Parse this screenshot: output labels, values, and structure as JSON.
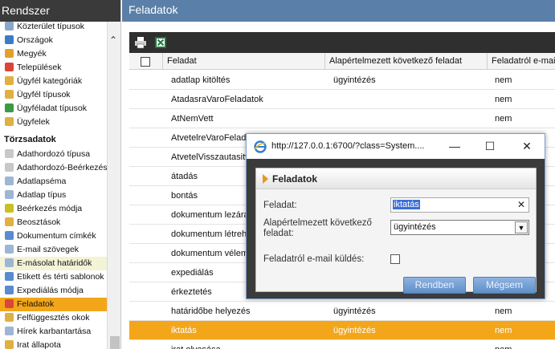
{
  "sidebar": {
    "title": "Rendszer",
    "items_top": [
      {
        "label": "Közterület típusok",
        "icon": "map-icon",
        "color": "#8aa6c8"
      },
      {
        "label": "Országok",
        "icon": "globe-icon",
        "color": "#3c7bc8"
      },
      {
        "label": "Megyék",
        "icon": "map-pin-icon",
        "color": "#e3a02b"
      },
      {
        "label": "Települések",
        "icon": "stop-icon",
        "color": "#d9463a"
      },
      {
        "label": "Ügyfél kategóriák",
        "icon": "users-icon",
        "color": "#e0b043"
      },
      {
        "label": "Ügyfél típusok",
        "icon": "users-icon",
        "color": "#e0b043"
      },
      {
        "label": "Ügyféladat típusok",
        "icon": "bookmark-icon",
        "color": "#3a9a46"
      },
      {
        "label": "Ügyfelek",
        "icon": "clients-icon",
        "color": "#e0b043"
      }
    ],
    "section": "Törzsadatok",
    "items_bottom": [
      {
        "label": "Adathordozó típusa",
        "icon": "disc-icon",
        "color": "#c8c8c8"
      },
      {
        "label": "Adathordozó-Beérkezés",
        "icon": "disc-icon",
        "color": "#c8c8c8"
      },
      {
        "label": "Adatlapséma",
        "icon": "form-icon",
        "color": "#9eb6d4"
      },
      {
        "label": "Adatlap típus",
        "icon": "form-icon",
        "color": "#9eb6d4"
      },
      {
        "label": "Beérkezés módja",
        "icon": "arrows-icon",
        "color": "#c9c025"
      },
      {
        "label": "Beosztások",
        "icon": "users-icon",
        "color": "#e0b043"
      },
      {
        "label": "Dokumentum címkék",
        "icon": "label-icon",
        "color": "#5a8ad0"
      },
      {
        "label": "E-mail szövegek",
        "icon": "mail-icon",
        "color": "#9eb6d4"
      },
      {
        "label": "E-másolat határidők",
        "icon": "mail-icon",
        "color": "#9eb6d4"
      },
      {
        "label": "Etikett és térti sablonok",
        "icon": "label-icon",
        "color": "#5a8ad0"
      },
      {
        "label": "Expediálás módja",
        "icon": "forward-icon",
        "color": "#5a8ad0"
      },
      {
        "label": "Feladatok",
        "icon": "tasks-icon",
        "color": "#d9463a"
      },
      {
        "label": "Felfüggesztés okok",
        "icon": "edit-icon",
        "color": "#e0b043"
      },
      {
        "label": "Hírek karbantartása",
        "icon": "news-icon",
        "color": "#9eb6d4"
      },
      {
        "label": "Irat állapota",
        "icon": "document-icon",
        "color": "#e0b043"
      }
    ]
  },
  "main": {
    "title": "Feladatok",
    "columns": [
      "Feladat",
      "Alapértelmezett következő feladat",
      "Feladatról e-mail küldés"
    ],
    "rows": [
      {
        "feladat": "adatlap kitöltés",
        "kovetkezo": "ügyintézés",
        "email": "nem"
      },
      {
        "feladat": "AtadasraVaroFeladatok",
        "kovetkezo": "",
        "email": "nem"
      },
      {
        "feladat": "AtNemVett",
        "kovetkezo": "",
        "email": "nem"
      },
      {
        "feladat": "AtvetelreVaroFeladatok",
        "kovetkezo": "",
        "email": "nem"
      },
      {
        "feladat": "AtvetelVisszautasitva",
        "kovetkezo": "",
        "email": "nem"
      },
      {
        "feladat": "átadás",
        "kovetkezo": "",
        "email": "nem"
      },
      {
        "feladat": "bontás",
        "kovetkezo": "",
        "email": "nem"
      },
      {
        "feladat": "dokumentum lezárás",
        "kovetkezo": "",
        "email": "nem"
      },
      {
        "feladat": "dokumentum létrehozás",
        "kovetkezo": "",
        "email": "nem"
      },
      {
        "feladat": "dokumentum vélemény",
        "kovetkezo": "",
        "email": "nem"
      },
      {
        "feladat": "expediálás",
        "kovetkezo": "",
        "email": "nem"
      },
      {
        "feladat": "érkeztetés",
        "kovetkezo": "",
        "email": "nem"
      },
      {
        "feladat": "határidőbe helyezés",
        "kovetkezo": "ügyintézés",
        "email": "nem"
      },
      {
        "feladat": "iktatás",
        "kovetkezo": "ügyintézés",
        "email": "nem"
      },
      {
        "feladat": "irat olvasása",
        "kovetkezo": "",
        "email": "nem"
      }
    ],
    "selected_row": 13
  },
  "popup": {
    "url": "http://127.0.0.1:6700/?class=System....",
    "dialog_title": "Feladatok",
    "feladat_label": "Feladat:",
    "feladat_value": "iktatás",
    "kovetkezo_label_1": "Alapértelmezett következő",
    "kovetkezo_label_2": "feladat:",
    "kovetkezo_value": "ügyintézés",
    "email_label": "Feladatról e-mail küldés:",
    "email_checked": false,
    "ok_label": "Rendben",
    "cancel_label": "Mégsem"
  }
}
